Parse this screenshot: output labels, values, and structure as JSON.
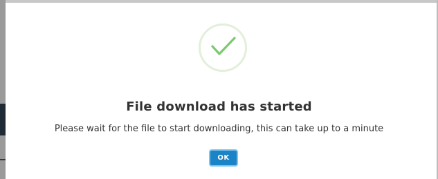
{
  "dialog": {
    "title": "File download has started",
    "message": "Please wait for the file to start downloading, this can take up to a minute",
    "ok_label": "OK",
    "icon": "check-icon"
  },
  "colors": {
    "check_stroke": "#7cc96f",
    "check_ring": "#e3efd9",
    "button_bg": "#1a84c7",
    "button_focus_ring": "#7ec3ee",
    "text": "#333333"
  }
}
